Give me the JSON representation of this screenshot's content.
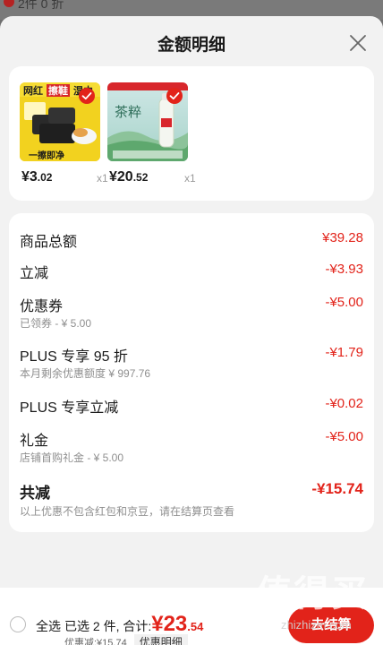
{
  "backdrop": {
    "peek_text": "2件 0 折"
  },
  "sheet": {
    "title": "金额明细"
  },
  "products": [
    {
      "price_int": "¥3",
      "price_dec": ".02",
      "qty": "x1",
      "image_texts": [
        "网红",
        "擦鞋",
        "湿巾",
        "一擦即净"
      ]
    },
    {
      "price_int": "¥20",
      "price_dec": ".52",
      "qty": "x1",
      "image_texts": [
        "茶粹"
      ]
    }
  ],
  "details": {
    "goods_total": {
      "label": "商品总额",
      "value": "¥39.28"
    },
    "instant_off": {
      "label": "立减",
      "value": "-¥3.93"
    },
    "coupon": {
      "label": "优惠券",
      "sub": "已领券 - ¥ 5.00",
      "value": "-¥5.00"
    },
    "plus_95": {
      "label": "PLUS 专享 95 折",
      "sub": "本月剩余优惠额度 ¥ 997.76",
      "value": "-¥1.79"
    },
    "plus_instant": {
      "label": "PLUS 专享立减",
      "value": "-¥0.02"
    },
    "gift": {
      "label": "礼金",
      "sub": "店铺首购礼金 - ¥ 5.00",
      "value": "-¥5.00"
    },
    "total": {
      "label": "共减",
      "value": "-¥15.74"
    },
    "note": "以上优惠不包含红包和京豆，请在结算页查看"
  },
  "bottom": {
    "select_all": "全选",
    "summary_prefix": "已选 2 件, 合计:",
    "amount_int": "¥23",
    "amount_dec": ".54",
    "discount": "优惠减:¥15.74",
    "detail_toggle": "优惠明细",
    "checkout": "去结算"
  },
  "watermark": {
    "big": "值得买",
    "small": "zhizhizm.com"
  },
  "colors": {
    "accent": "#e2231a",
    "sheet_bg": "#f2f2f2"
  }
}
